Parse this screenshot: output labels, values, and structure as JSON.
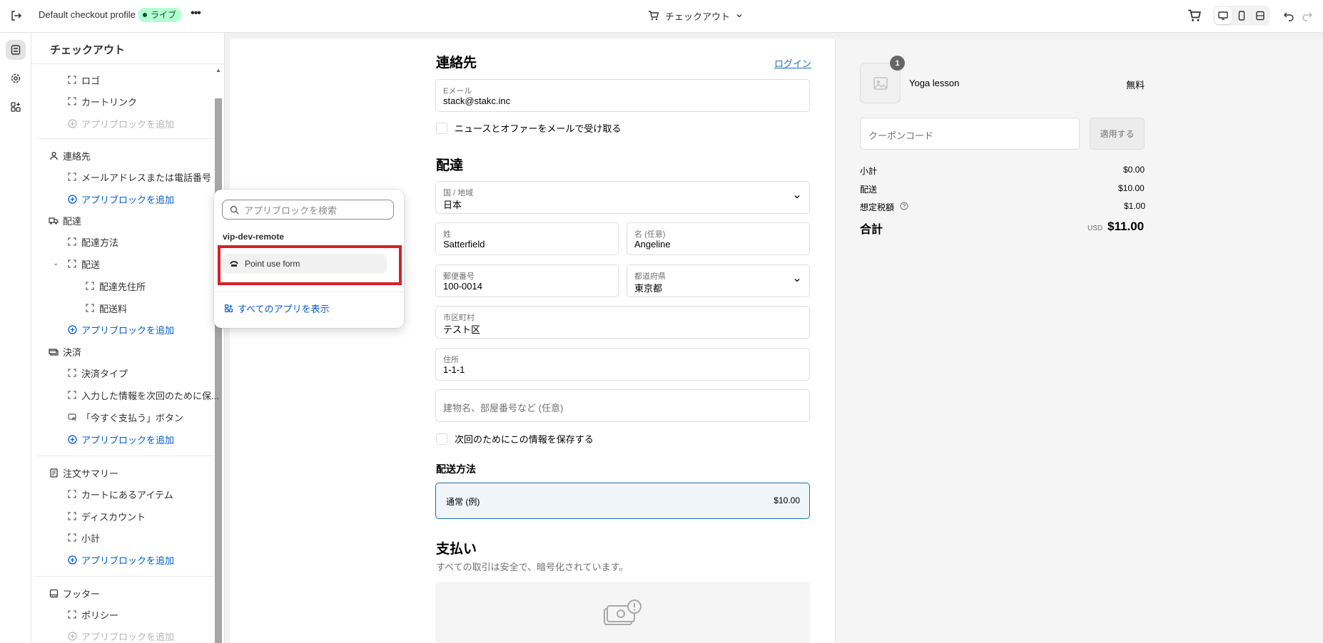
{
  "topbar": {
    "profile_title": "Default checkout profile",
    "status_badge": "ライブ",
    "more": "•••",
    "page_selector": "チェックアウト"
  },
  "sidebar": {
    "title": "チェックアウト",
    "header_items": [
      "ロゴ",
      "カートリンク"
    ],
    "add_app_block": "アプリブロックを追加",
    "sections": {
      "contact": {
        "label": "連絡先",
        "items": [
          "メールアドレスまたは電話番号"
        ]
      },
      "delivery": {
        "label": "配達",
        "items": [
          "配達方法",
          "配送"
        ],
        "sub_items": [
          "配達先住所",
          "配送料"
        ]
      },
      "payment": {
        "label": "決済",
        "items": [
          "決済タイプ",
          "入力した情報を次回のために保...",
          "「今すぐ支払う」ボタン"
        ]
      },
      "order_summary": {
        "label": "注文サマリー",
        "items": [
          "カートにあるアイテム",
          "ディスカウント",
          "小計"
        ]
      },
      "footer": {
        "label": "フッター",
        "items": [
          "ポリシー"
        ]
      }
    }
  },
  "popover": {
    "search_placeholder": "アプリブロックを検索",
    "group": "vip-dev-remote",
    "item": "Point use form",
    "show_all": "すべてのアプリを表示"
  },
  "checkout": {
    "contact": {
      "heading": "連絡先",
      "login": "ログイン",
      "email_label": "Eメール",
      "email_value": "stack@stakc.inc",
      "newsletter": "ニュースとオファーをメールで受け取る"
    },
    "delivery": {
      "heading": "配達",
      "country_label": "国 / 地域",
      "country_value": "日本",
      "last_name_label": "姓",
      "last_name_value": "Satterfield",
      "first_name_label": "名 (任意)",
      "first_name_value": "Angeline",
      "postal_label": "郵便番号",
      "postal_value": "100-0014",
      "prefecture_label": "都道府県",
      "prefecture_value": "東京都",
      "city_label": "市区町村",
      "city_value": "テスト区",
      "address_label": "住所",
      "address_value": "1-1-1",
      "apartment_placeholder": "建物名、部屋番号など (任意)",
      "save_info": "次回のためにこの情報を保存する"
    },
    "shipping": {
      "heading": "配送方法",
      "option_name": "通常 (例)",
      "option_price": "$10.00"
    },
    "payment": {
      "heading": "支払い",
      "subtitle": "すべての取引は安全で、暗号化されています。"
    }
  },
  "summary": {
    "quantity": "1",
    "product": "Yoga lesson",
    "product_price": "無料",
    "coupon_placeholder": "クーポンコード",
    "apply": "適用する",
    "subtotal_label": "小計",
    "subtotal": "$0.00",
    "shipping_label": "配送",
    "shipping": "$10.00",
    "tax_label": "想定税額",
    "tax": "$1.00",
    "total_label": "合計",
    "currency": "USD",
    "total": "$11.00"
  },
  "colors": {
    "accent": "#1773b0",
    "admin_link": "#005bd3",
    "highlight": "#d4212b",
    "live_badge": "#b4fed2"
  }
}
